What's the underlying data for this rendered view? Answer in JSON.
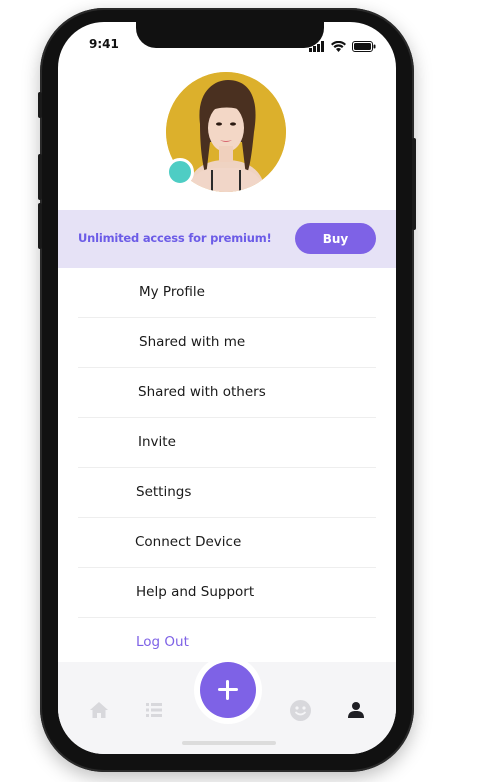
{
  "status_bar": {
    "time": "9:41",
    "icons": [
      "signal-icon",
      "wifi-icon",
      "battery-icon"
    ]
  },
  "profile": {
    "avatar": "user-avatar",
    "online_status_color": "#4ecdc4"
  },
  "premium": {
    "text": "Unlimited access for premium!",
    "buy_label": "Buy"
  },
  "menu": {
    "items": [
      {
        "label": "My Profile"
      },
      {
        "label": "Shared with me"
      },
      {
        "label": "Shared with others"
      },
      {
        "label": "Invite"
      },
      {
        "label": "Settings"
      },
      {
        "label": "Connect Device"
      },
      {
        "label": "Help and Support"
      },
      {
        "label": "Log Out"
      }
    ]
  },
  "tabbar": {
    "tabs": [
      "home-icon",
      "list-icon",
      "add-icon",
      "emoji-icon",
      "profile-icon"
    ],
    "active": "profile-icon"
  },
  "colors": {
    "accent": "#7e62e6",
    "banner_bg": "#e6e2f6",
    "status_dot": "#4ecdc4"
  }
}
